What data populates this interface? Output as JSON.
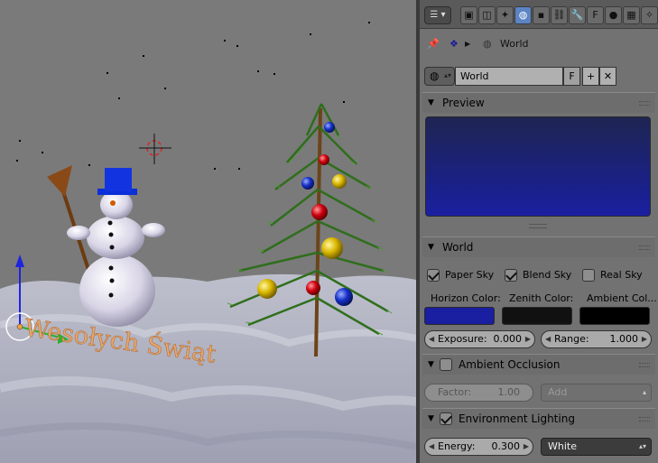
{
  "viewport": {
    "text_3d": "Wesołych Świąt",
    "bg_color": "#7a7a7a",
    "text_color": "#e7a86a"
  },
  "header": {
    "editor_type_icon": "properties-editor-icon",
    "context_tabs": [
      {
        "icon": "render-icon",
        "glyph": "▣",
        "active": false
      },
      {
        "icon": "render-layers-icon",
        "glyph": "◫",
        "active": false
      },
      {
        "icon": "scene-icon",
        "glyph": "✦",
        "active": false
      },
      {
        "icon": "world-icon",
        "glyph": "◍",
        "active": true
      },
      {
        "icon": "object-icon",
        "glyph": "▪",
        "active": false
      },
      {
        "icon": "constraints-icon",
        "glyph": "⛓",
        "active": false
      },
      {
        "icon": "modifiers-icon",
        "glyph": "🔧",
        "active": false
      },
      {
        "icon": "text-data-icon",
        "glyph": "F",
        "active": false
      },
      {
        "icon": "material-icon",
        "glyph": "●",
        "active": false
      },
      {
        "icon": "texture-icon",
        "glyph": "▦",
        "active": false
      },
      {
        "icon": "particles-icon",
        "glyph": "✧",
        "active": false
      }
    ]
  },
  "breadcrumb": {
    "pin_icon": "pin-icon",
    "scene_icon": "scene-data-icon",
    "world_label": "World"
  },
  "world_id": {
    "name": "World",
    "fake_user": "F",
    "add": "+",
    "unlink": "✕"
  },
  "panels": {
    "preview": {
      "title": "Preview",
      "gradient_top": "#1f2552",
      "gradient_bottom": "#1b1fa0"
    },
    "world": {
      "title": "World",
      "paper_sky": {
        "label": "Paper Sky",
        "checked": true
      },
      "blend_sky": {
        "label": "Blend Sky",
        "checked": true
      },
      "real_sky": {
        "label": "Real Sky",
        "checked": false
      },
      "horizon_label": "Horizon Color:",
      "zenith_label": "Zenith Color:",
      "ambient_label": "Ambient Col...",
      "horizon_color": "#1a1ea0",
      "zenith_color": "#111111",
      "ambient_color": "#000000",
      "exposure_label": "Exposure:",
      "exposure_value": "0.000",
      "range_label": "Range:",
      "range_value": "1.000"
    },
    "ambient_occlusion": {
      "title": "Ambient Occlusion",
      "enabled": false,
      "factor_label": "Factor:",
      "factor_value": "1.00",
      "blend_mode": "Add"
    },
    "environment_lighting": {
      "title": "Environment Lighting",
      "enabled": true,
      "energy_label": "Energy:",
      "energy_value": "0.300",
      "color_mode": "White"
    }
  }
}
